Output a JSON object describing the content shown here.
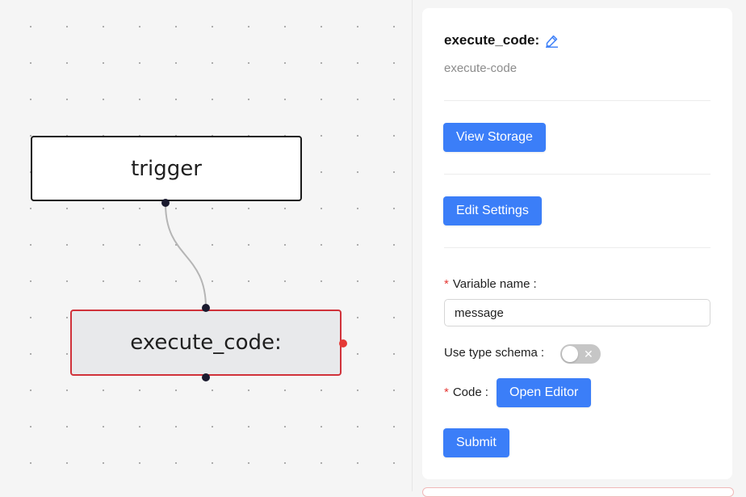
{
  "canvas": {
    "nodes": [
      {
        "id": "trigger",
        "label": "trigger"
      },
      {
        "id": "execute_code",
        "label": "execute_code:"
      }
    ]
  },
  "panel": {
    "title": "execute_code:",
    "subtitle": "execute-code",
    "view_storage_label": "View Storage",
    "edit_settings_label": "Edit Settings",
    "variable_name_label": "Variable name",
    "variable_name_value": "message",
    "use_type_schema_label": "Use type schema",
    "use_type_schema_enabled": false,
    "code_label": "Code",
    "open_editor_label": "Open Editor",
    "submit_label": "Submit",
    "required_mark": "*",
    "label_colon": ":"
  },
  "colors": {
    "accent": "#3b7ef8",
    "selected_border": "#d0323a",
    "required": "#e53935"
  },
  "icons": {
    "title_edit": "edit-icon",
    "toggle_off": "close-icon"
  }
}
